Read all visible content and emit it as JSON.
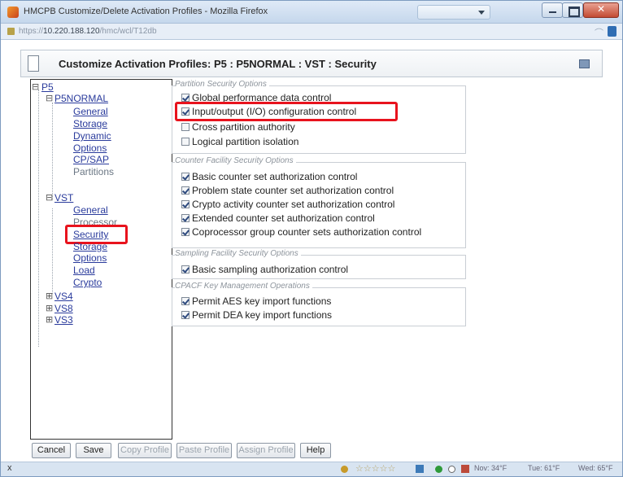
{
  "window": {
    "title": "HMCPB Customize/Delete Activation Profiles - Mozilla Firefox",
    "url_prefix": "https://",
    "url_host": "10.220.188.120",
    "url_path": "/hmc/wcl/T12db"
  },
  "dialog": {
    "title": "Customize Activation Profiles: P5 : P5NORMAL : VST : Security"
  },
  "tree": {
    "root": "P5",
    "p5normal": "P5NORMAL",
    "p5normal_children": [
      "General",
      "Storage",
      "Dynamic",
      "Options",
      "CP/SAP",
      "Partitions"
    ],
    "vst": "VST",
    "vst_children": [
      "General",
      "Processor",
      "Security",
      "Storage",
      "Options",
      "Load",
      "Crypto"
    ],
    "others": [
      "VS4",
      "VS8",
      "VS3"
    ]
  },
  "sections": {
    "partition_security": {
      "legend": "Partition Security Options",
      "options": [
        {
          "label": "Global performance data control",
          "checked": true
        },
        {
          "label": "Input/output (I/O) configuration control",
          "checked": true
        },
        {
          "label": "Cross partition authority",
          "checked": false
        },
        {
          "label": "Logical partition isolation",
          "checked": false
        }
      ]
    },
    "counter_facility": {
      "legend": "Counter Facility Security Options",
      "options": [
        {
          "label": "Basic counter set authorization control",
          "checked": true
        },
        {
          "label": "Problem state counter set authorization control",
          "checked": true
        },
        {
          "label": "Crypto activity counter set authorization control",
          "checked": true
        },
        {
          "label": "Extended counter set authorization control",
          "checked": true
        },
        {
          "label": "Coprocessor group counter sets authorization control",
          "checked": true
        }
      ]
    },
    "sampling_facility": {
      "legend": "Sampling Facility Security Options",
      "options": [
        {
          "label": "Basic sampling authorization control",
          "checked": true
        }
      ]
    },
    "cpacf": {
      "legend": "CPACF Key Management Operations",
      "options": [
        {
          "label": "Permit AES key import functions",
          "checked": true
        },
        {
          "label": "Permit DEA key import functions",
          "checked": true
        }
      ]
    }
  },
  "buttons": {
    "cancel": "Cancel",
    "save": "Save",
    "copy_profile": "Copy Profile",
    "paste_profile": "Paste Profile",
    "assign_profile": "Assign Profile",
    "help": "Help"
  },
  "statusbar": {
    "left": "x",
    "stars": "☆☆☆☆☆",
    "item1": "Nov: 34°F",
    "item2": "Tue: 61°F",
    "item3": "Wed: 65°F"
  },
  "colors": {
    "highlight": "#e8131d",
    "link": "#2a3b9c"
  }
}
